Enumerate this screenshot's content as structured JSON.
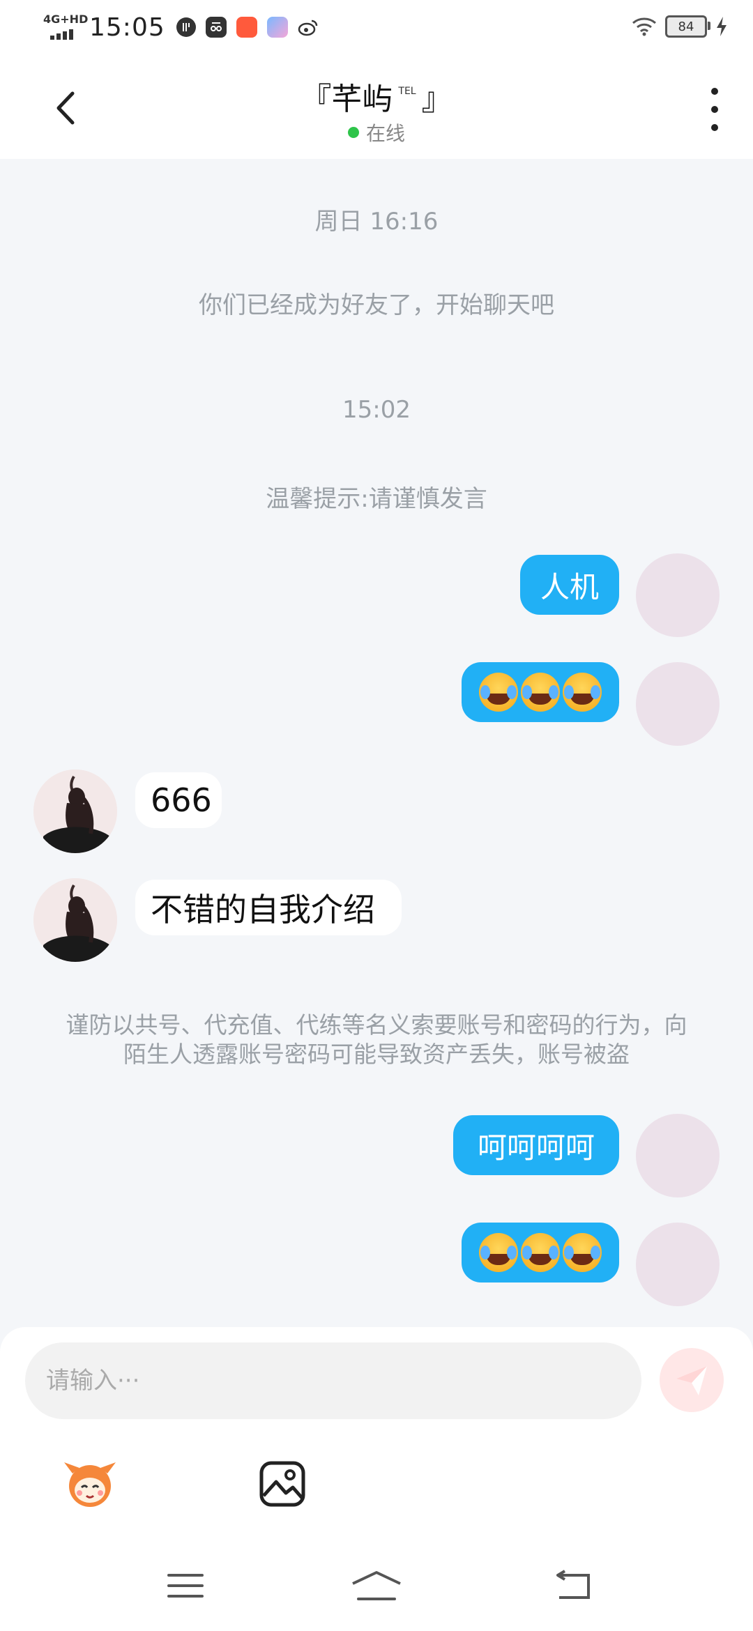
{
  "status_bar": {
    "network": "4G+HD",
    "time": "15:05",
    "battery": "84"
  },
  "header": {
    "title_left": "『芊屿",
    "title_sup": "TEL",
    "title_right": "』",
    "status": "在线"
  },
  "chat": {
    "system_1": "周日 16:16",
    "system_2": "你们已经成为好友了，开始聊天吧",
    "system_3": "15:02",
    "system_4": "温馨提示:请谨慎发言",
    "out_1": "人机",
    "in_1": "666",
    "in_2": "不错的自我介绍",
    "warning": "谨防以共号、代充值、代练等名义索要账号和密码的行为，向陌生人透露账号密码可能导致资产丢失，账号被盗",
    "out_3": "呵呵呵呵"
  },
  "composer": {
    "placeholder": "请输入···"
  },
  "colors": {
    "accent_blue": "#21b0f5",
    "online_green": "#2ec44a",
    "send_tint": "#ffe7e7"
  }
}
